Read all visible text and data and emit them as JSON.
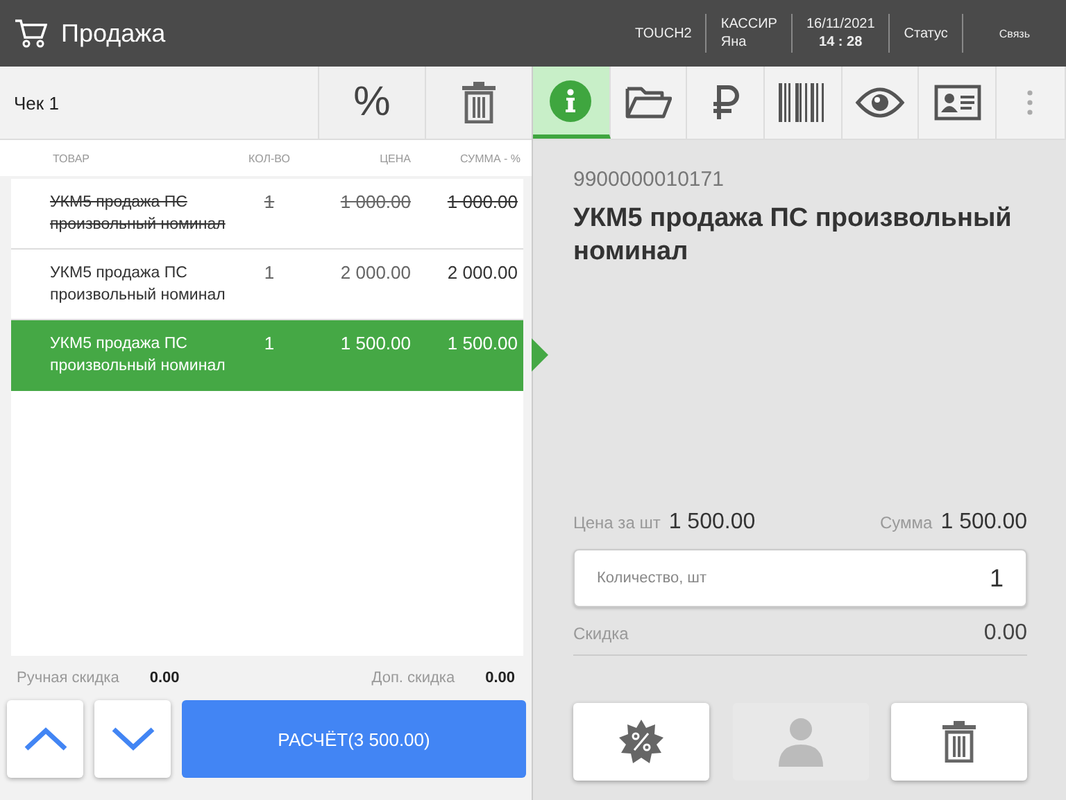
{
  "header": {
    "title": "Продажа",
    "terminal": "TOUCH2",
    "cashier_label": "КАССИР",
    "cashier": "Яна",
    "date": "16/11/2021",
    "time": "14 : 28",
    "status": "Статус",
    "connection": "Связь"
  },
  "receipt": {
    "title": "Чек 1"
  },
  "left_tools": [
    {
      "kind": "percent",
      "label": "%"
    },
    {
      "kind": "trash"
    }
  ],
  "tabs": [
    {
      "kind": "info",
      "selected": true
    },
    {
      "kind": "folder",
      "selected": false
    },
    {
      "kind": "ruble",
      "selected": false
    },
    {
      "kind": "barcode",
      "selected": false
    },
    {
      "kind": "eye",
      "selected": false
    },
    {
      "kind": "card",
      "selected": false
    },
    {
      "kind": "more",
      "selected": false
    }
  ],
  "table": {
    "columns": [
      "ТОВАР",
      "КОЛ-ВО",
      "ЦЕНА",
      "СУММА - %"
    ],
    "rows": [
      {
        "name": "УКМ5 продажа ПС произвольный номинал",
        "qty": "1",
        "price": "1 000.00",
        "sum": "1 000.00",
        "voided": true,
        "selected": false
      },
      {
        "name": "УКМ5 продажа ПС произвольный номинал",
        "qty": "1",
        "price": "2 000.00",
        "sum": "2 000.00",
        "voided": false,
        "selected": false
      },
      {
        "name": "УКМ5 продажа ПС произвольный номинал",
        "qty": "1",
        "price": "1 500.00",
        "sum": "1 500.00",
        "voided": false,
        "selected": true
      }
    ]
  },
  "totals": {
    "manual_discount_label": "Ручная скидка",
    "manual_discount": "0.00",
    "extra_discount_label": "Доп. скидка",
    "extra_discount": "0.00"
  },
  "pay_button": "РАСЧЁТ(3 500.00)",
  "detail": {
    "barcode": "9900000010171",
    "name": "УКМ5 продажа ПС произвольный номинал",
    "unit_price_label": "Цена за шт",
    "unit_price": "1 500.00",
    "sum_label": "Сумма",
    "sum": "1 500.00",
    "quantity_placeholder": "Количество, шт",
    "quantity": "1",
    "discount_label": "Скидка",
    "discount": "0.00"
  },
  "actions": [
    {
      "kind": "discount",
      "disabled": false
    },
    {
      "kind": "customer",
      "disabled": true
    },
    {
      "kind": "trash",
      "disabled": false
    }
  ]
}
